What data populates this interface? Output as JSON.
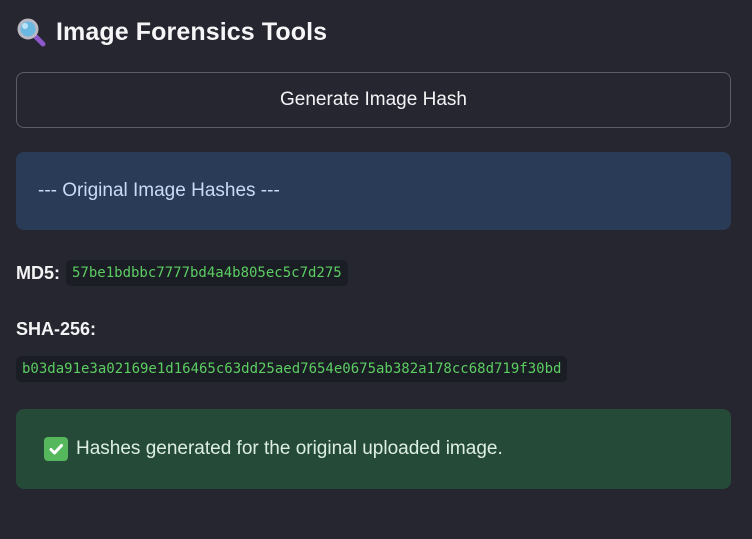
{
  "header": {
    "title": "Image Forensics Tools",
    "icon": "magnifying-glass-icon"
  },
  "actions": {
    "generate_label": "Generate Image Hash"
  },
  "info": {
    "message": "--- Original Image Hashes ---"
  },
  "hashes": {
    "md5_label": "MD5:",
    "md5_value": "57be1bdbbc7777bd4a4b805ec5c7d275",
    "sha256_label": "SHA-256:",
    "sha256_value": "b03da91e3a02169e1d16465c63dd25aed7654e0675ab382a178cc68d719f30bd"
  },
  "status": {
    "icon": "check-mark-icon",
    "message": "Hashes generated for the original uploaded image."
  },
  "colors": {
    "background": "#262630",
    "info_background": "#293b56",
    "success_background": "#264a38",
    "code_text": "#5ccd63"
  }
}
